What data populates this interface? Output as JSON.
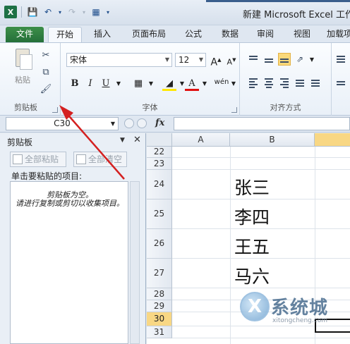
{
  "window": {
    "title": "新建 Microsoft Excel 工作表"
  },
  "tabs": [
    {
      "label": "文件"
    },
    {
      "label": "开始"
    },
    {
      "label": "插入"
    },
    {
      "label": "页面布局"
    },
    {
      "label": "公式"
    },
    {
      "label": "数据"
    },
    {
      "label": "审阅"
    },
    {
      "label": "视图"
    },
    {
      "label": "加载项"
    }
  ],
  "ribbon": {
    "clipboard": {
      "group_label": "剪贴板",
      "paste_label": "粘贴"
    },
    "font": {
      "group_label": "字体",
      "font_name": "宋体",
      "font_size": "12",
      "bold": "B",
      "italic": "I",
      "underline": "U",
      "font_color_glyph": "A",
      "phonetic_glyph": "wén"
    },
    "alignment": {
      "group_label": "对齐方式"
    }
  },
  "formula_bar": {
    "name_box": "C30",
    "fx": "fx",
    "value": ""
  },
  "clipboard_pane": {
    "title": "剪贴板",
    "paste_all_label": "全部粘贴",
    "clear_all_label": "全部清空",
    "hint": "单击要粘贴的项目:",
    "empty_line1": "剪贴板为空。",
    "empty_line2": "请进行复制或剪切以收集项目。"
  },
  "sheet": {
    "columns": [
      "A",
      "B"
    ],
    "rows": [
      {
        "num": "22",
        "value": ""
      },
      {
        "num": "23",
        "value": ""
      },
      {
        "num": "24",
        "value": "张三"
      },
      {
        "num": "25",
        "value": "李四"
      },
      {
        "num": "26",
        "value": "王五"
      },
      {
        "num": "27",
        "value": "马六"
      },
      {
        "num": "28",
        "value": ""
      },
      {
        "num": "29",
        "value": ""
      },
      {
        "num": "30",
        "value": ""
      },
      {
        "num": "31",
        "value": ""
      }
    ],
    "selected_row": "30"
  },
  "watermark": {
    "logo_letter": "X",
    "text": "系统城",
    "sub": "xitongcheng.com"
  },
  "colors": {
    "file_tab": "#25703a",
    "annotation_arrow": "#d42020",
    "selected_row_header": "#f8d784"
  }
}
